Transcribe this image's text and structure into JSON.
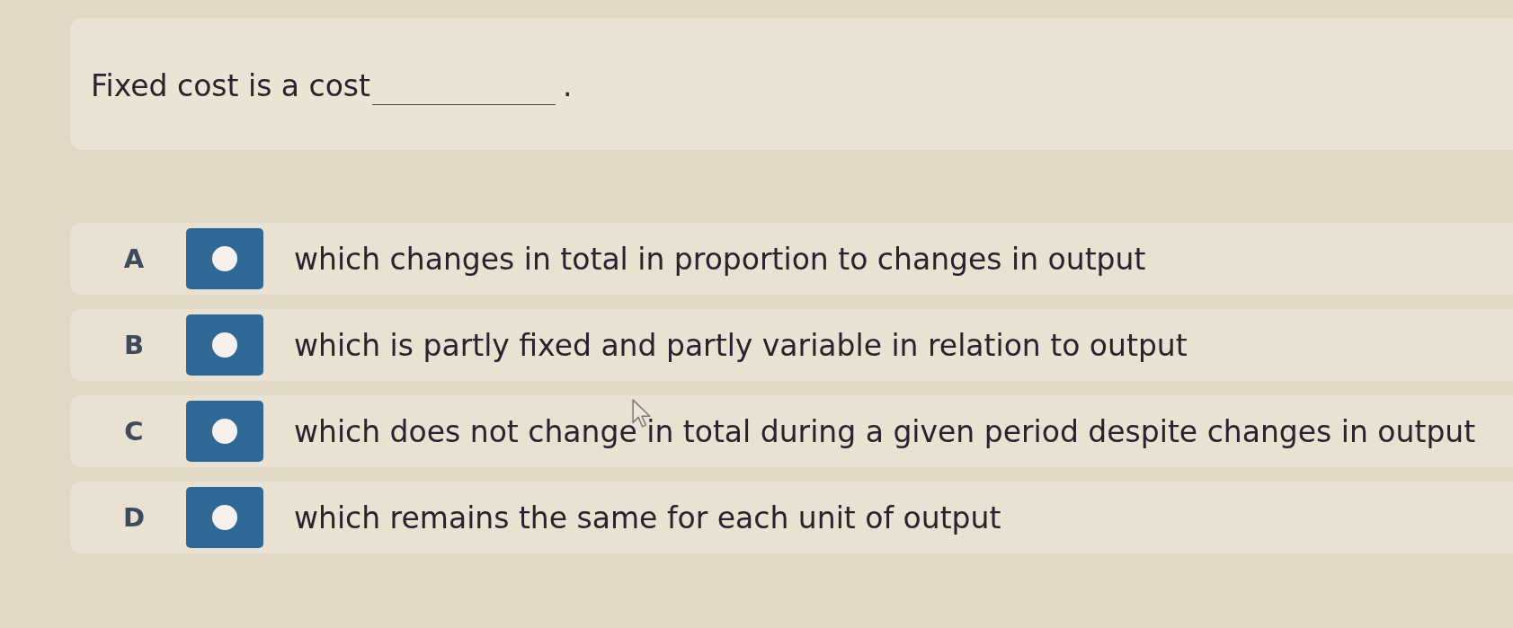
{
  "question": {
    "text": "Fixed cost is a cost",
    "end": "."
  },
  "options": [
    {
      "letter": "A",
      "text": "which changes in total in proportion to changes in output",
      "selected": false
    },
    {
      "letter": "B",
      "text": "which is partly fixed and partly variable in relation to output",
      "selected": false
    },
    {
      "letter": "C",
      "text": "which does not change in total during a given period despite changes in output",
      "selected": false,
      "pointer": true
    },
    {
      "letter": "D",
      "text": "which remains the same for each unit of output",
      "selected": false
    }
  ]
}
